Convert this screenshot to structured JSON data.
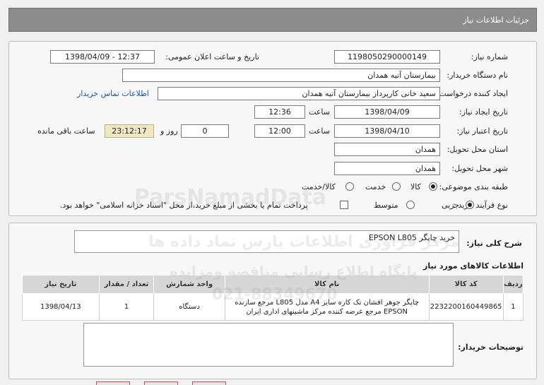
{
  "header": {
    "title": "جزئیات اطلاعات نیاز"
  },
  "form": {
    "need_number_label": "شماره نیاز:",
    "need_number": "1198050290000149",
    "announce_label": "تاریخ و ساعت اعلان عمومی:",
    "announce_value": "1398/04/09 - 12:37",
    "buyer_org_label": "نام دستگاه خریدار:",
    "buyer_org": "بیمارستان آتیه همدان",
    "requester_label": "ایجاد کننده درخواست:",
    "requester": "سعید خانی کارپرداز بیمارستان آتیه همدان",
    "contact_link": "اطلاعات تماس خریدار",
    "created_label": "تاریخ ایجاد نیاز:",
    "created_date": "1398/04/09",
    "time_label": "ساعت",
    "created_time": "12:36",
    "validity_label": "تاریخ اعتبار نیاز:",
    "validity_date": "1398/04/10",
    "validity_time": "12:00",
    "days_value": "0",
    "days_label": "روز و",
    "remaining_value": "23:12:17",
    "remaining_label": "ساعت باقی مانده",
    "province_label": "استان محل تحویل:",
    "province": "همدان",
    "city_label": "شهر محل تحویل:",
    "city": "همدان",
    "category_label": "طبقه بندی موضوعی:",
    "category_options": [
      "کالا",
      "خدمت",
      "کالا/خدمت"
    ],
    "category_selected": "کالا",
    "process_label": "نوع فرآیند خرید :",
    "process_options": [
      "جزیی",
      "متوسط"
    ],
    "process_selected": "جزیی",
    "payment_note": "پرداخت تمام یا بخشی از مبلغ خرید،از محل \"اسناد خزانه اسلامی\" خواهد بود."
  },
  "description": {
    "label": "شرح کلی نیاز:",
    "value": "خرید چاپگر EPSON L805"
  },
  "goods": {
    "title": "اطلاعات کالاهای مورد نیاز",
    "columns": [
      "ردیف",
      "کد کالا",
      "نام کالا",
      "واحد شمارش",
      "تعداد / مقدار",
      "تاریخ نیاز"
    ],
    "rows": [
      {
        "index": "1",
        "code": "2232200160449865",
        "name": "چاپگر جوهر افشان تک کاره سایز A4 مدل L805 مرجع سازنده EPSON مرجع عرضه کننده مرکز ماشینهای اداری ایران",
        "unit": "دستگاه",
        "qty": "1",
        "date": "1398/04/13"
      }
    ]
  },
  "buyer_notes": {
    "label": "توضیحات خریدار:",
    "value": ""
  },
  "watermarks": {
    "brand": "ParsNamadData",
    "line1": "مرکز فرآوری اطلاعات پارس نماد داده ها",
    "line2": "پایگاه اطلاع رسانی مناقصه ومزایده",
    "phone": "021-88349670"
  },
  "colors": {
    "header_bg": "#8c8c8c",
    "link": "#1a55b5",
    "remaining_bg": "#efe8c4"
  }
}
